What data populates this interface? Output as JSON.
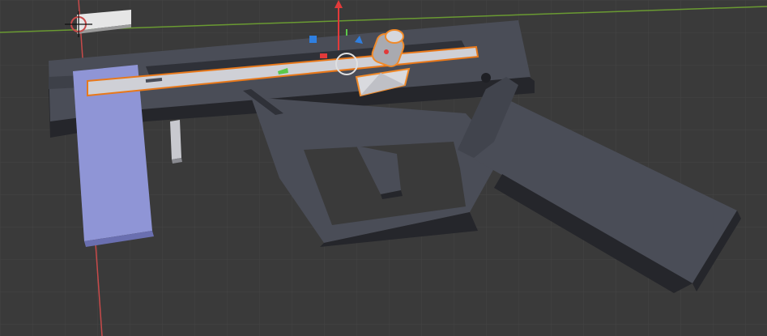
{
  "viewport": {
    "name": "3D Viewport",
    "background_color": "#3a3a3a",
    "grid_line_color": "#444444",
    "x_axis_color": "#c84a4a",
    "y_axis_color": "#6a9a32",
    "selection_outline_color": "#e8781a",
    "active_object_outline_color": "#f08a2a",
    "mesh_dark_color": "#4a4d57",
    "mesh_shadow_color": "#25262b",
    "selected_face_color": "#8f95d6",
    "light_face_color": "#cfd0d6"
  },
  "gizmo": {
    "z_arrow_color": "#e23a3a",
    "x_handle_color": "#2f7fe0",
    "y_handle_color": "#5bc84a",
    "center_circle_color": "#e0e0e0"
  },
  "scene": {
    "objects": [
      {
        "name": "light-object"
      },
      {
        "name": "receiver-frame"
      },
      {
        "name": "grip"
      },
      {
        "name": "stock-block"
      },
      {
        "name": "slide-rail"
      },
      {
        "name": "post-cylinder"
      }
    ]
  }
}
